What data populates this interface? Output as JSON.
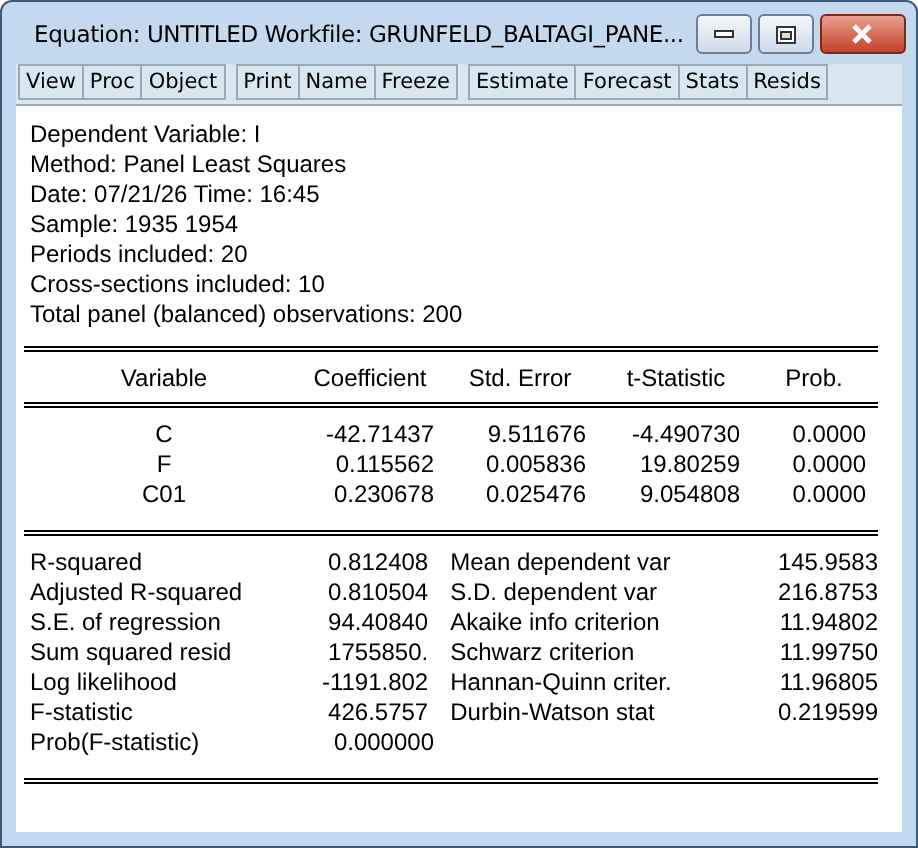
{
  "window": {
    "title": "Equation: UNTITLED   Workfile: GRUNFELD_BALTAGI_PANE..."
  },
  "toolbar": [
    [
      "View",
      "Proc",
      "Object"
    ],
    [
      "Print",
      "Name",
      "Freeze"
    ],
    [
      "Estimate",
      "Forecast",
      "Stats",
      "Resids"
    ]
  ],
  "header_lines": [
    "Dependent Variable: I",
    "Method: Panel Least Squares",
    "Date: 07/21/26   Time: 16:45",
    "Sample: 1935 1954",
    "Periods included: 20",
    "Cross-sections included: 10",
    "Total panel (balanced) observations: 200"
  ],
  "coef_table": {
    "columns": [
      "Variable",
      "Coefficient",
      "Std. Error",
      "t-Statistic",
      "Prob."
    ],
    "rows": [
      [
        "C",
        "-42.71437",
        "9.511676",
        "-4.490730",
        "0.0000"
      ],
      [
        "F",
        "0.115562",
        "0.005836",
        "19.80259",
        "0.0000"
      ],
      [
        "C01",
        "0.230678",
        "0.025476",
        "9.054808",
        "0.0000"
      ]
    ]
  },
  "stats": [
    [
      "R-squared",
      "0.812408",
      "Mean dependent var",
      "145.9583"
    ],
    [
      "Adjusted R-squared",
      "0.810504",
      "S.D. dependent var",
      "216.8753"
    ],
    [
      "S.E. of regression",
      "94.40840",
      "Akaike info criterion",
      "11.94802"
    ],
    [
      "Sum squared resid",
      "1755850.",
      "Schwarz criterion",
      "11.99750"
    ],
    [
      "Log likelihood",
      "-1191.802",
      "Hannan-Quinn criter.",
      "11.96805"
    ],
    [
      "F-statistic",
      "426.5757",
      "Durbin-Watson stat",
      "0.219599"
    ],
    [
      "Prob(F-statistic)",
      "0.000000"
    ]
  ]
}
